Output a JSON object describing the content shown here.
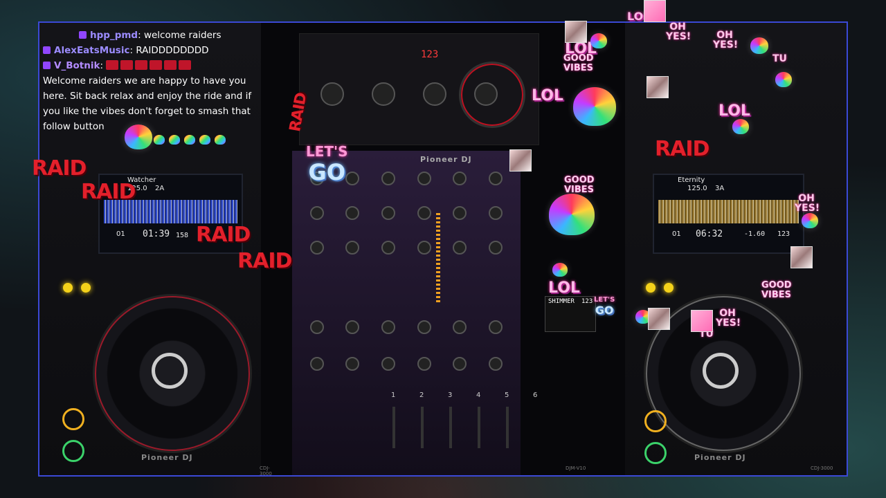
{
  "chat": {
    "messages": [
      {
        "user": "hpp_pmd",
        "text": "welcome raiders"
      },
      {
        "user": "AlexEatsMusic",
        "text": "RAIDDDDDDDD"
      },
      {
        "user": "V_Botnik",
        "text": "Welcome raiders we are happy to have you here. Sit back relax and enjoy the ride and if you like the vibes don't forget to smash that follow button"
      }
    ]
  },
  "overlay": {
    "raid_label": "RAID",
    "lol_label": "LOL",
    "good_vibes": "GOOD VIBES",
    "oh_yes": "OH YES!",
    "lets": "LET'S",
    "go": "GO",
    "tu": "TU"
  },
  "mixer": {
    "brand": "Pioneer DJ",
    "model": "DJM-V10",
    "channels": [
      "1",
      "2",
      "3",
      "4",
      "5",
      "6"
    ],
    "bpm_display": "123",
    "fx_name": "SHIMMER",
    "fx_bpm": "123",
    "top_display": "123"
  },
  "deck_left": {
    "brand": "Pioneer DJ",
    "model": "CDJ-3000",
    "track": "Watcher",
    "bpm": "125.0",
    "key": "2A",
    "time": "01:39",
    "time_ms": "158",
    "track_no": "01"
  },
  "deck_right": {
    "brand": "Pioneer DJ",
    "model": "CDJ-3000",
    "track": "Eternity",
    "bpm": "125.0",
    "key": "3A",
    "time": "06:32",
    "pitch": "-1.60",
    "track_no": "01",
    "master_bpm": "123"
  },
  "colors": {
    "frame_border": "#3b49d6",
    "raid_red": "#e3202b",
    "twitch_purple": "#9146ff"
  }
}
